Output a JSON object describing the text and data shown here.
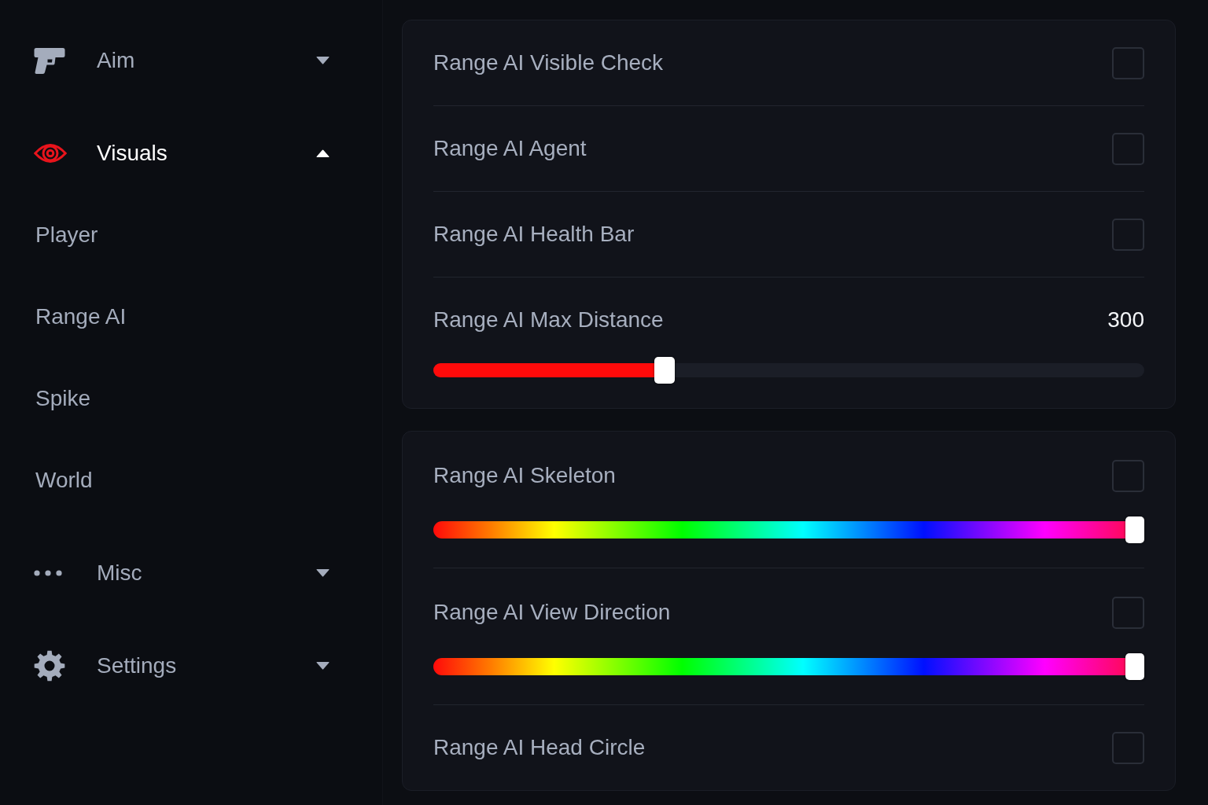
{
  "sidebar": {
    "sections": [
      {
        "label": "Aim",
        "selected": false,
        "expanded": false
      },
      {
        "label": "Visuals",
        "selected": true,
        "expanded": true,
        "children": [
          {
            "label": "Player"
          },
          {
            "label": "Range AI"
          },
          {
            "label": "Spike"
          },
          {
            "label": "World"
          }
        ]
      },
      {
        "label": "Misc",
        "selected": false,
        "expanded": false
      },
      {
        "label": "Settings",
        "selected": false,
        "expanded": false
      }
    ]
  },
  "panels": [
    {
      "rows": [
        {
          "kind": "checkbox",
          "label": "Range AI Visible Check",
          "checked": false
        },
        {
          "kind": "checkbox",
          "label": "Range AI Agent",
          "checked": false
        },
        {
          "kind": "checkbox",
          "label": "Range AI Health Bar",
          "checked": false
        },
        {
          "kind": "slider",
          "label": "Range AI Max Distance",
          "value": "300",
          "level": 0.32
        }
      ]
    },
    {
      "rows": [
        {
          "kind": "color",
          "label": "Range AI Skeleton",
          "checked": false,
          "level": 1
        },
        {
          "kind": "color",
          "label": "Range AI View Direction",
          "checked": false,
          "level": 1
        },
        {
          "kind": "checkbox",
          "label": "Range AI Head Circle",
          "checked": false
        }
      ]
    }
  ]
}
